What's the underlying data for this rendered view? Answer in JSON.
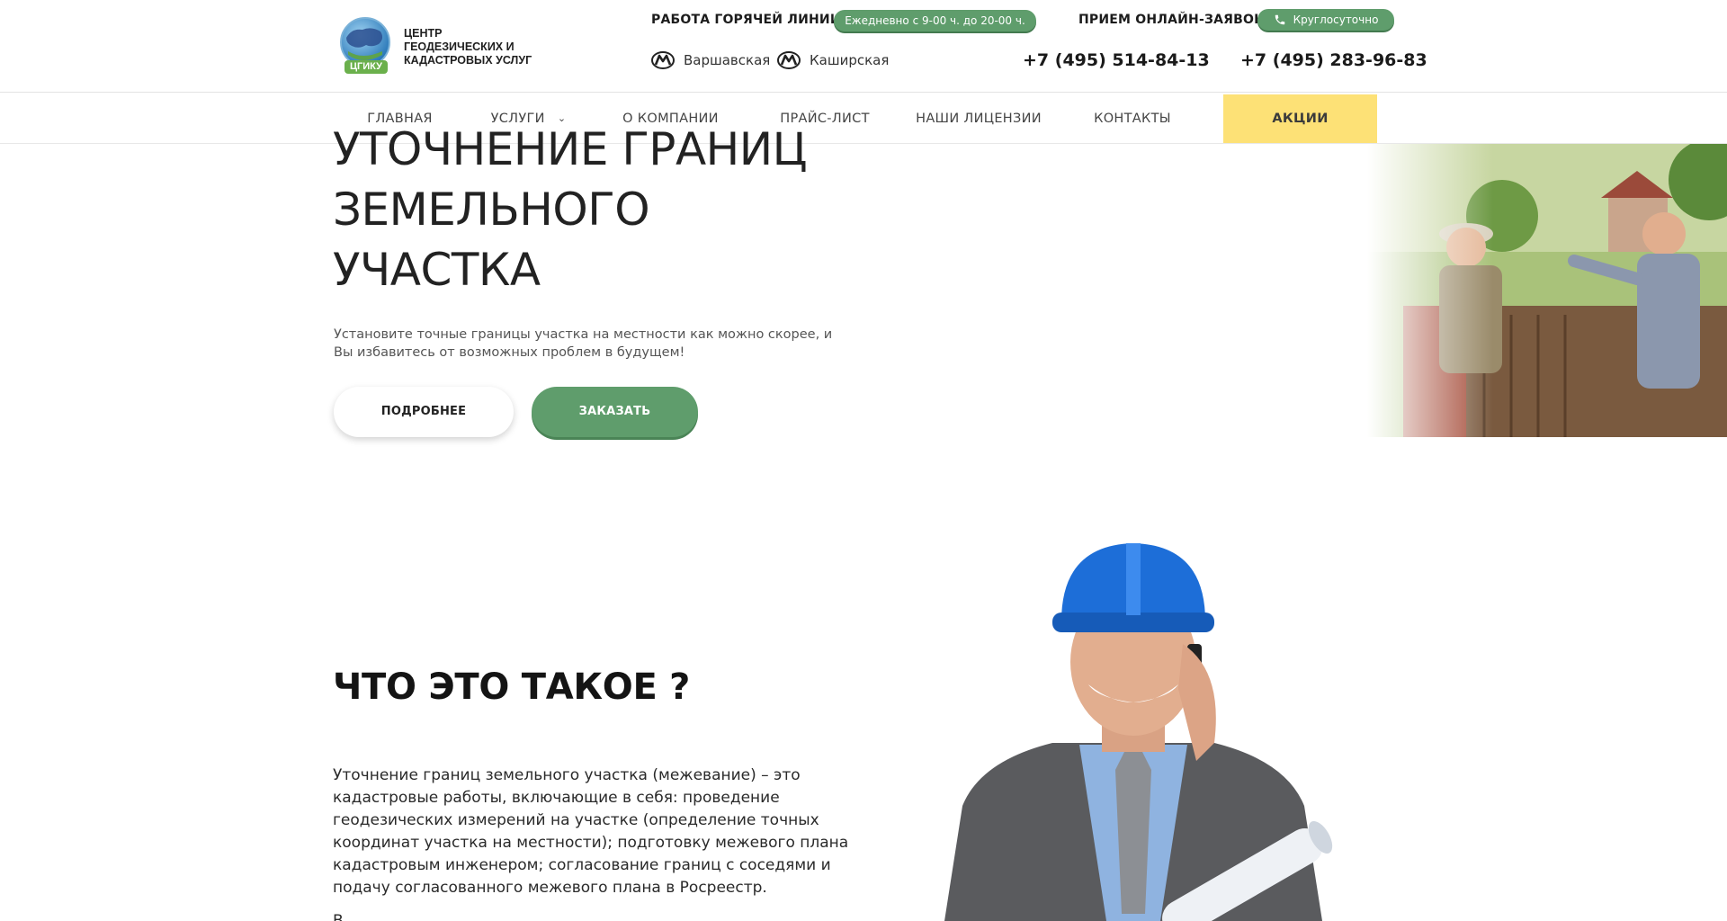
{
  "header": {
    "logo": {
      "title": "ЦЕНТР ГЕОДЕЗИЧЕСКИХ И КАДАСТРОВЫХ УСЛУГ",
      "badge": "ЦГИКУ"
    },
    "hotline_label": "РАБОТА ГОРЯЧЕЙ ЛИНИИ:",
    "hotline_hours": "Ежедневно с 9-00 ч. до 20-00 ч.",
    "online_label": "ПРИЕМ ОНЛАЙН-ЗАЯВОК:",
    "online_value": "Круглосуточно",
    "metro": [
      "Варшавская",
      "Каширская"
    ],
    "phones": [
      "+7 (495) 514-84-13",
      "+7 (495) 283-96-83"
    ]
  },
  "nav": {
    "items": [
      "ГЛАВНАЯ",
      "УСЛУГИ",
      "О КОМПАНИИ",
      "ПРАЙС-ЛИСТ",
      "НАШИ ЛИЦЕНЗИИ",
      "КОНТАКТЫ",
      "АКЦИИ"
    ],
    "accent_color": "#fde176"
  },
  "hero": {
    "title": "УТОЧНЕНИЕ ГРАНИЦ ЗЕМЕЛЬНОГО УЧАСТКА",
    "subtitle": "Установите точные границы участка на местности как можно скорее, и Вы избавитесь от возможных проблем в будущем!",
    "btn_more": "ПОДРОБНЕЕ",
    "btn_order": "ЗАКАЗАТЬ"
  },
  "section": {
    "title": "ЧТО ЭТО ТАКОЕ ?",
    "text": "Уточнение границ земельного участка (межевание) – это кадастровые работы, включающие в себя: проведение геодезических измерений на участке (определение точных координат участка на местности); подготовку межевого плана кадастровым инженером; согласование границ с соседями и подачу согласованного межевого плана в Росреестр.",
    "text2": "В"
  },
  "colors": {
    "green": "#5f9d6c",
    "yellow": "#fde176"
  },
  "icons": [
    "metro-icon",
    "phone-icon",
    "chevron-down-icon"
  ]
}
